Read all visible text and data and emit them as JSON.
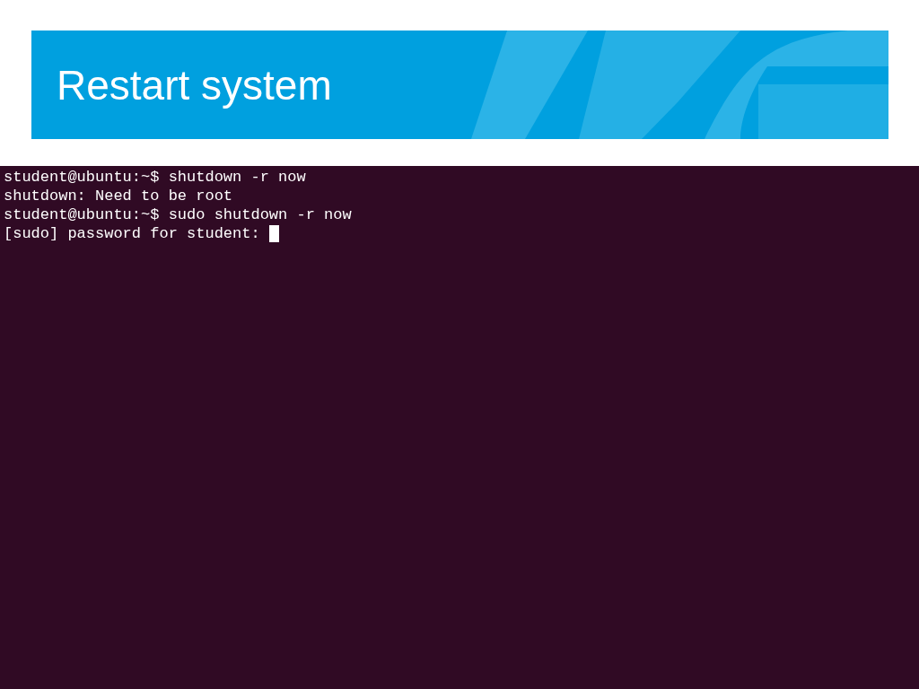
{
  "slide": {
    "title": "Restart system"
  },
  "terminal": {
    "lines": [
      "student@ubuntu:~$ shutdown -r now",
      "shutdown: Need to be root",
      "student@ubuntu:~$ sudo shutdown -r now",
      "[sudo] password for student: "
    ]
  }
}
